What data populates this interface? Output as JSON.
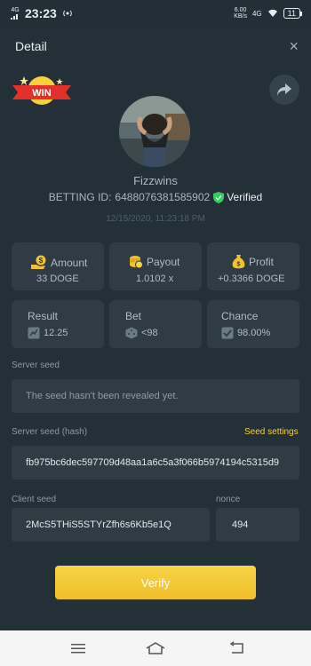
{
  "status_bar": {
    "network": "4G",
    "time": "23:23",
    "speed": "6.00",
    "speed_unit": "KB/s",
    "network_right": "4G",
    "battery": "11"
  },
  "header": {
    "title": "Detail",
    "close": "×"
  },
  "badge": {
    "text": "WIN"
  },
  "user": {
    "name": "Fizzwins",
    "bet_id_label": "BETTING ID:",
    "bet_id": "6488076381585902",
    "verified": "Verified",
    "timestamp": "12/15/2020, 11:23:18 PM"
  },
  "stats": {
    "amount_label": "Amount",
    "amount_value": "33 DOGE",
    "payout_label": "Payout",
    "payout_value": "1.0102 x",
    "profit_label": "Profit",
    "profit_value": "+0.3366 DOGE",
    "result_label": "Result",
    "result_value": "12.25",
    "bet_label": "Bet",
    "bet_value": "<98",
    "chance_label": "Chance",
    "chance_value": "98.00%"
  },
  "seeds": {
    "server_seed_label": "Server seed",
    "server_seed_placeholder": "The seed hasn't been revealed yet.",
    "server_hash_label": "Server seed (hash)",
    "seed_settings": "Seed settings",
    "server_hash_value": "fb975bc6dec597709d48aa1a6c5a3f066b5974194c5315d9",
    "client_seed_label": "Client seed",
    "client_seed_value": "2McS5THiS5STYrZfh6s6Kb5e1Q",
    "nonce_label": "nonce",
    "nonce_value": "494"
  },
  "actions": {
    "verify": "Verify"
  },
  "colors": {
    "background": "#243037",
    "card": "#2f3c43",
    "accent": "#f4cf3a",
    "verified_green": "#2bd35a",
    "win_red": "#e2312b"
  }
}
